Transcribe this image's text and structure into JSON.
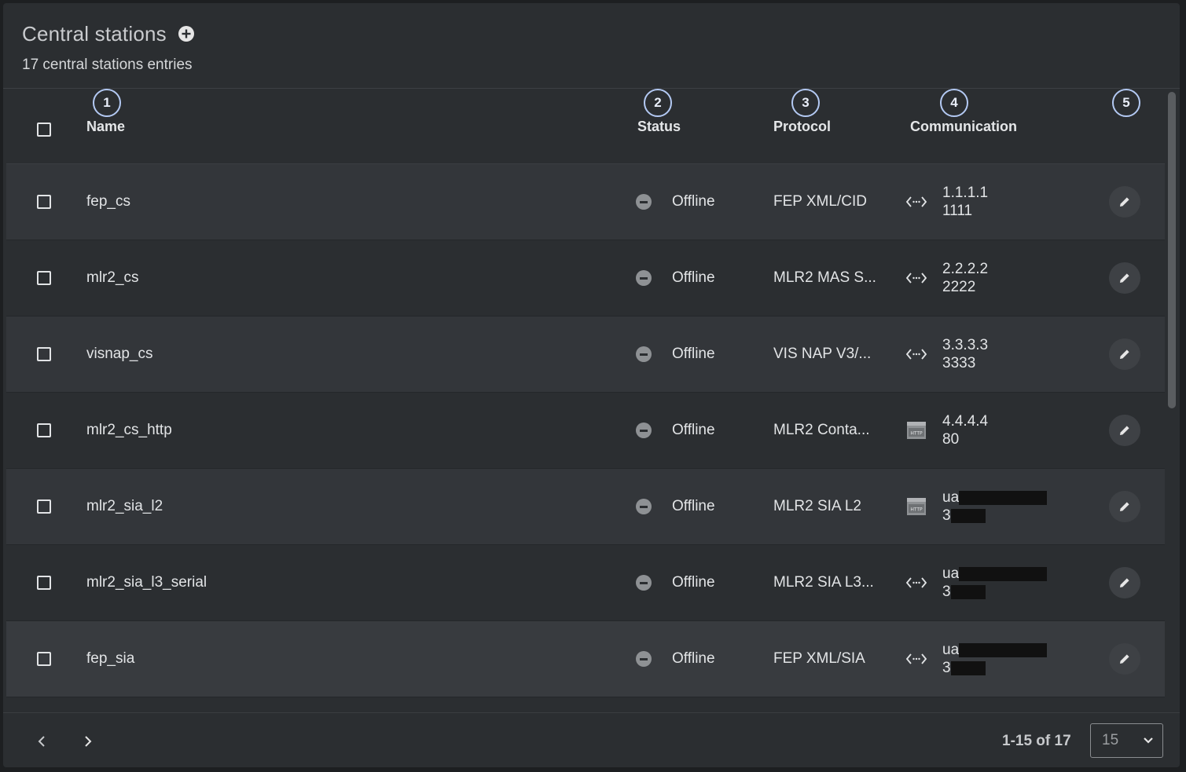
{
  "header": {
    "title": "Central stations",
    "subtitle": "17 central stations entries"
  },
  "columns": {
    "name": "Name",
    "status": "Status",
    "protocol": "Protocol",
    "communication": "Communication"
  },
  "markers": [
    "1",
    "2",
    "3",
    "4",
    "5"
  ],
  "rows": [
    {
      "name": "fep_cs",
      "status": "Offline",
      "protocol": "FEP XML/CID",
      "comm_icon": "code-arrows-icon",
      "line1": "1.1.1.1",
      "line2": "1111"
    },
    {
      "name": "mlr2_cs",
      "status": "Offline",
      "protocol": "MLR2 MAS S...",
      "comm_icon": "code-arrows-icon",
      "line1": "2.2.2.2",
      "line2": "2222"
    },
    {
      "name": "visnap_cs",
      "status": "Offline",
      "protocol": "VIS NAP V3/...",
      "comm_icon": "code-arrows-icon",
      "line1": "3.3.3.3",
      "line2": "3333"
    },
    {
      "name": "mlr2_cs_http",
      "status": "Offline",
      "protocol": "MLR2 Conta...",
      "comm_icon": "http-icon",
      "line1": "4.4.4.4",
      "line2": "80"
    },
    {
      "name": "mlr2_sia_l2",
      "status": "Offline",
      "protocol": "MLR2 SIA L2",
      "comm_icon": "http-icon",
      "line1": "ua",
      "line2": "3"
    },
    {
      "name": "mlr2_sia_l3_serial",
      "status": "Offline",
      "protocol": "MLR2 SIA L3...",
      "comm_icon": "code-arrows-icon",
      "line1": "ua",
      "line2": "3"
    },
    {
      "name": "fep_sia",
      "status": "Offline",
      "protocol": "FEP XML/SIA",
      "comm_icon": "code-arrows-icon",
      "line1": "ua",
      "line2": "3"
    }
  ],
  "footer": {
    "range": "1-15 of 17",
    "page_size": "15"
  },
  "colors": {
    "panel": "#2b2e31",
    "row_alt": "#33363a",
    "marker": "#b3c9f3",
    "status_offline": "#8e9194"
  }
}
